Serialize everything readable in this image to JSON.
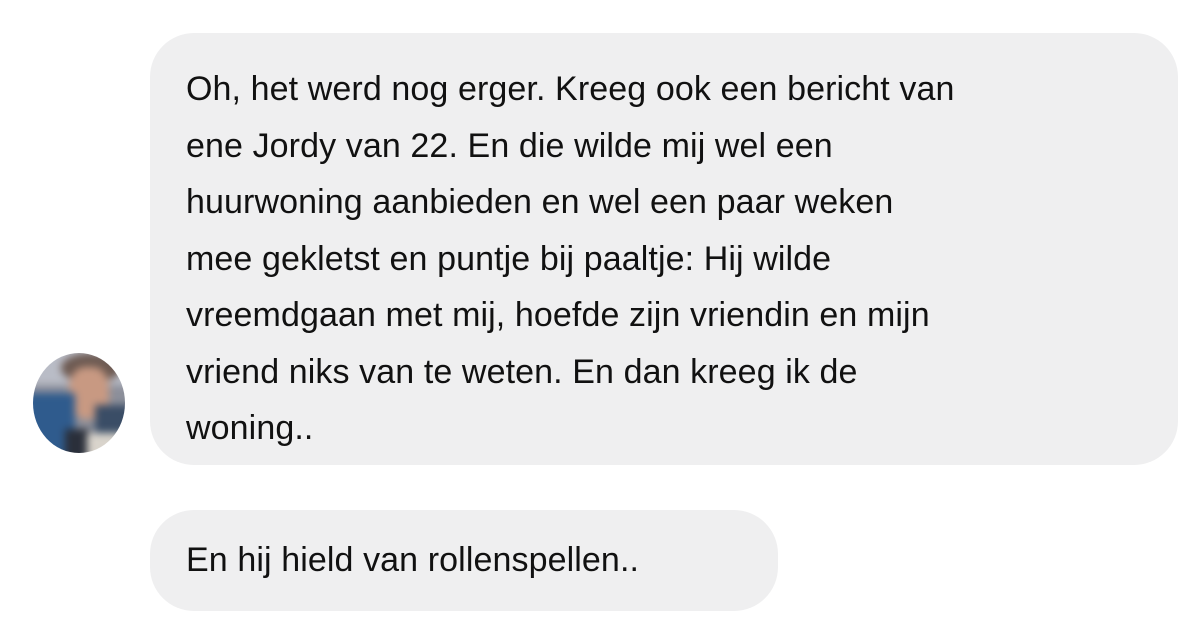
{
  "conversation": {
    "incoming_avatar": {
      "icon": "blurred-profile-photo",
      "description_hidden": true
    },
    "messages": [
      {
        "lines": [
          "Oh, het werd nog erger. Kreeg ook een bericht van",
          "ene Jordy van 22. En die wilde mij wel een",
          "huurwoning aanbieden en wel een paar weken",
          "mee gekletst en puntje bij paaltje: Hij wilde",
          "vreemdgaan met mij, hoefde zijn vriendin en mijn",
          "vriend niks van te weten. En dan kreeg ik de",
          "woning.."
        ]
      },
      {
        "lines": [
          "En hij hield van rollenspellen.."
        ]
      }
    ]
  },
  "colors": {
    "bubble_background": "#efeff0",
    "text": "#111111",
    "page_background": "#ffffff"
  }
}
